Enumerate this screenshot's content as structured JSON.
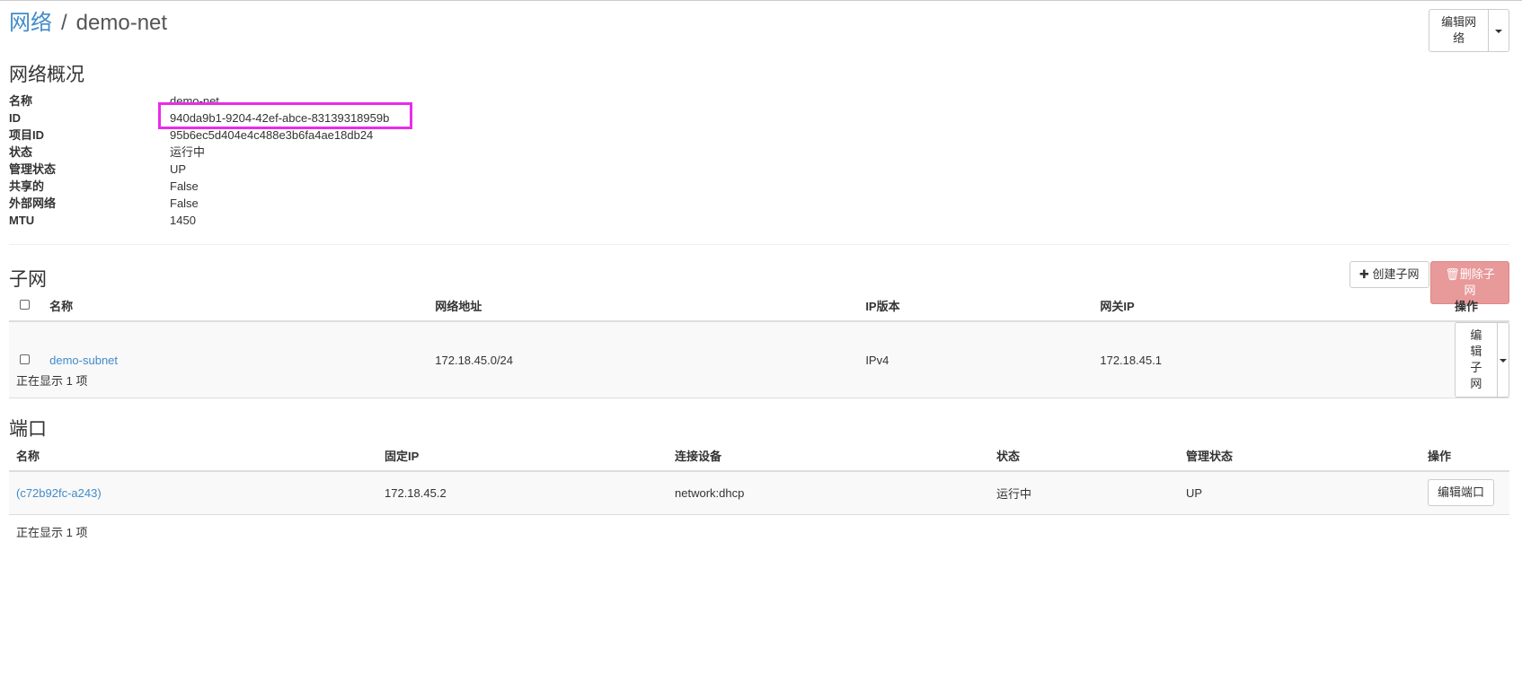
{
  "breadcrumb": {
    "parent": "网络",
    "separator": "/",
    "current": "demo-net"
  },
  "header": {
    "edit_network_label": "编辑网络"
  },
  "overview": {
    "title": "网络概况",
    "rows": [
      {
        "label": "名称",
        "value": "demo-net"
      },
      {
        "label": "ID",
        "value": "940da9b1-9204-42ef-abce-83139318959b"
      },
      {
        "label": "项目ID",
        "value": "95b6ec5d404e4c488e3b6fa4ae18db24"
      },
      {
        "label": "状态",
        "value": "运行中"
      },
      {
        "label": "管理状态",
        "value": "UP"
      },
      {
        "label": "共享的",
        "value": "False"
      },
      {
        "label": "外部网络",
        "value": "False"
      },
      {
        "label": "MTU",
        "value": "1450"
      }
    ]
  },
  "subnets": {
    "title": "子网",
    "create_label": "创建子网",
    "delete_label": "删除子网",
    "columns": [
      "名称",
      "网络地址",
      "IP版本",
      "网关IP",
      "操作"
    ],
    "rows": [
      {
        "name": "demo-subnet",
        "cidr": "172.18.45.0/24",
        "ip_version": "IPv4",
        "gateway": "172.18.45.1",
        "action": "编辑子网"
      }
    ],
    "count_text": "正在显示 1 项"
  },
  "ports": {
    "title": "端口",
    "columns": [
      "名称",
      "固定IP",
      "连接设备",
      "状态",
      "管理状态",
      "操作"
    ],
    "rows": [
      {
        "name": "(c72b92fc-a243)",
        "fixed_ip": "172.18.45.2",
        "device": "network:dhcp",
        "status": "运行中",
        "admin_state": "UP",
        "action": "编辑端口"
      }
    ],
    "count_text": "正在显示 1 项"
  },
  "colors": {
    "link": "#428bca",
    "highlight": "#e92ce9",
    "danger_disabled": "#e8999a"
  }
}
